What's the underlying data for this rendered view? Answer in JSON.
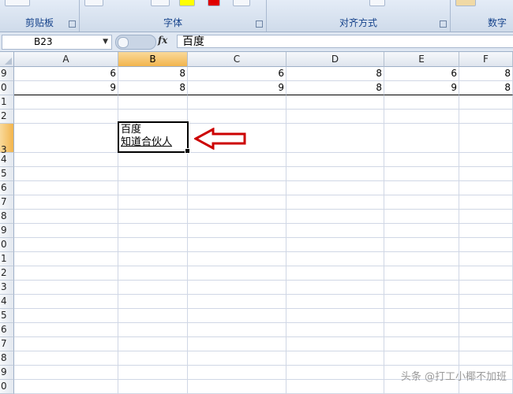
{
  "ribbon": {
    "groups": [
      {
        "label": "剪贴板"
      },
      {
        "label": "字体"
      },
      {
        "label": "对齐方式"
      },
      {
        "label": "数字"
      }
    ]
  },
  "formula_bar": {
    "name_box": "B23",
    "formula": "百度"
  },
  "columns": [
    "A",
    "B",
    "C",
    "D",
    "E",
    "F"
  ],
  "active_column": "B",
  "rows": [
    {
      "header": "9",
      "values": [
        "6",
        "8",
        "6",
        "8",
        "6",
        "8"
      ]
    },
    {
      "header": "0",
      "values": [
        "9",
        "8",
        "9",
        "8",
        "9",
        "8"
      ]
    },
    {
      "header": "1"
    },
    {
      "header": "2"
    },
    {
      "header": "3"
    },
    {
      "header": "4"
    },
    {
      "header": "5"
    },
    {
      "header": "6"
    },
    {
      "header": "7"
    },
    {
      "header": "8"
    },
    {
      "header": "9"
    },
    {
      "header": "0"
    },
    {
      "header": "1"
    },
    {
      "header": "2"
    },
    {
      "header": "3"
    },
    {
      "header": "4"
    },
    {
      "header": "5"
    },
    {
      "header": "6"
    },
    {
      "header": "7"
    },
    {
      "header": "8"
    },
    {
      "header": "9"
    },
    {
      "header": "0"
    }
  ],
  "active_row_header": "3",
  "selected_cell": {
    "line1": "百度",
    "line2": "知道合伙人"
  },
  "annotation": {
    "arrow_color": "#cc0000",
    "direction": "left"
  },
  "watermark": "头条 @打工小椰不加班"
}
